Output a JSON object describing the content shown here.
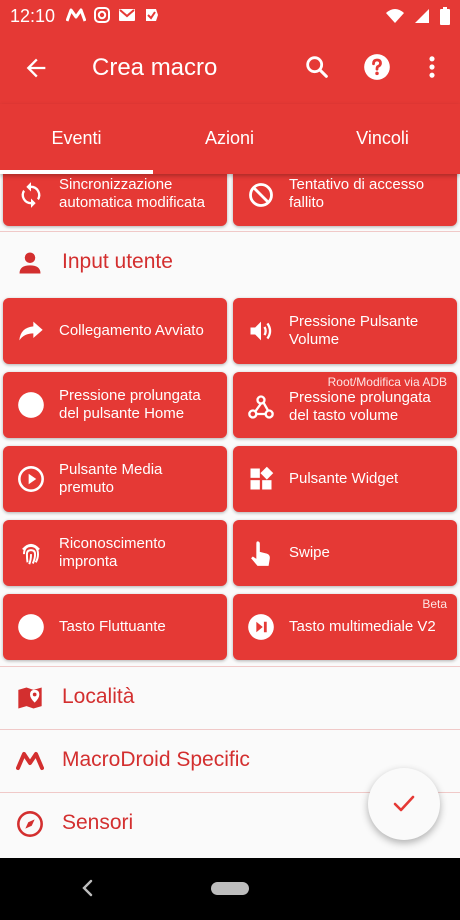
{
  "status_bar": {
    "time": "12:10",
    "icons": [
      "macrodroid-icon",
      "instagram-icon",
      "gmail-icon",
      "tasks-icon"
    ],
    "right_icons": [
      "wifi-icon",
      "signal-icon",
      "battery-icon"
    ]
  },
  "app_bar": {
    "title": "Crea macro"
  },
  "tabs": [
    {
      "label": "Eventi",
      "selected": true
    },
    {
      "label": "Azioni",
      "selected": false
    },
    {
      "label": "Vincoli",
      "selected": false
    }
  ],
  "top_partial": [
    {
      "label": "Sincronizzazione automatica modificata",
      "icon": "sync-icon"
    },
    {
      "label": "Tentativo di accesso fallito",
      "icon": "block-icon"
    }
  ],
  "sections": {
    "input_utente": {
      "title": "Input utente",
      "icon": "person-icon"
    },
    "localita": {
      "title": "Località",
      "icon": "map-pin-icon"
    },
    "macrodroid": {
      "title": "MacroDroid Specific",
      "icon": "macrodroid-icon"
    },
    "sensori": {
      "title": "Sensori",
      "icon": "compass-icon"
    }
  },
  "input_cards": [
    {
      "label": "Collegamento Avviato",
      "icon": "share-arrow-icon",
      "tag": ""
    },
    {
      "label": "Pressione Pulsante Volume",
      "icon": "volume-icon",
      "tag": ""
    },
    {
      "label": "Pressione prolungata del pulsante Home",
      "icon": "circle-icon",
      "tag": ""
    },
    {
      "label": "Pressione prolungata del tasto volume",
      "icon": "webhook-icon",
      "tag": "Root/Modifica via ADB"
    },
    {
      "label": "Pulsante Media premuto",
      "icon": "play-circle-icon",
      "tag": ""
    },
    {
      "label": "Pulsante Widget",
      "icon": "widgets-icon",
      "tag": ""
    },
    {
      "label": "Riconoscimento impronta",
      "icon": "fingerprint-icon",
      "tag": ""
    },
    {
      "label": "Swipe",
      "icon": "swipe-hand-icon",
      "tag": ""
    },
    {
      "label": "Tasto Fluttuante",
      "icon": "circle-icon",
      "tag": ""
    },
    {
      "label": "Tasto multimediale V2",
      "icon": "skip-play-icon",
      "tag": "Beta"
    }
  ],
  "colors": {
    "primary": "#e53935",
    "section_text": "#d32f2f",
    "background": "#fafafa"
  }
}
